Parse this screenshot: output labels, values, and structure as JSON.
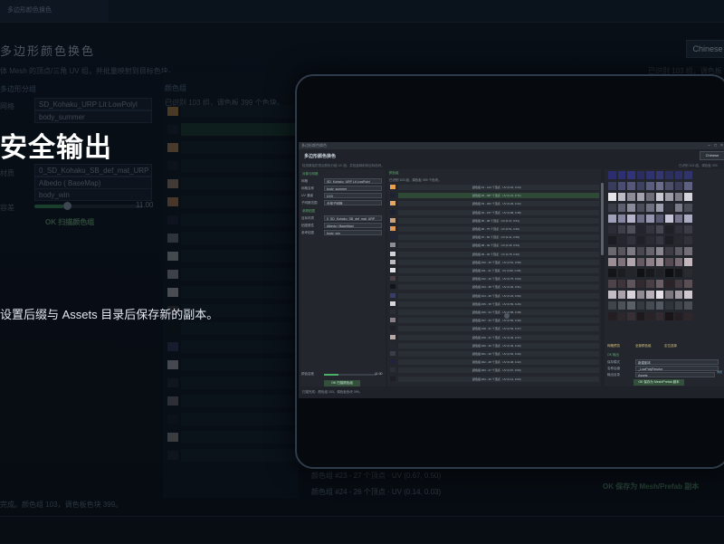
{
  "background": {
    "tab_title": "多边形颜色换色",
    "title": "多边形颜色换色",
    "language": "Chinese",
    "hint": "体 Mesh 的顶点/三角 UV 组，并批量映射到目标色块。",
    "stats": "已识别 103 组，调色板 399 个",
    "left_section": "多边形分组",
    "field_rows": [
      {
        "label": "网格",
        "value": "SD_Kohaku_URP Lit LowPolyl"
      },
      {
        "label": "",
        "value": "body_summer"
      },
      {
        "label": "材质",
        "value": "0_SD_Kohaku_SB_def_mat_URP"
      },
      {
        "label": "",
        "value": "Albedo ( BaseMap)"
      },
      {
        "label": "",
        "value": "body_win"
      }
    ],
    "slider_label": "容差",
    "slider_value": "11.00",
    "slider_fraction": 0.27,
    "scan_button": "OK 扫描颜色组",
    "list_header": "颜色组",
    "list_info": "已识别 103 组，调色板 399 个色块。",
    "bottom_rows": [
      "颜色组 #23 - 27 个顶点 · UV (0.67, 0.50)",
      "颜色组 #24 - 26 个顶点 · UV (0.14, 0.03)"
    ],
    "save_button": "OK 保存为 Mesh/Prefab 副本",
    "status": "完成。颜色组 103，调色板色块 399。"
  },
  "overlay": {
    "headline": "安全输出",
    "subtext": "设置后缀与 Assets 目录后保存新的副本。"
  },
  "screen": {
    "window_title": "多边形颜色换色",
    "title": "多边形颜色换色",
    "language": "Chinese",
    "hint": "检测原始的顶点颜色分组 UV 组，并批量映射到目标色块。",
    "stats": "已识别 103 组，调色板 399",
    "section1": "对象与网格",
    "mesh_label": "网格",
    "mesh_value": "SD_Kohaku_URP Lit LowPolyl",
    "uv_label": "网格名称",
    "uv_value": "body_summer",
    "uvch_label": "UV 通道",
    "uvch_value": "UV0",
    "mode_label": "子网格范围",
    "mode_value": "全部子网格",
    "section2": "参照贴图",
    "mat_label": "目标材质",
    "mat_value": "0_SD_Kohaku_SB_def_mat_URP",
    "tex_label": "贴图属性",
    "tex_value": "Albedo ( BaseMap)",
    "ref_label": "参考贴图",
    "ref_value": "body_win",
    "tol_label": "颜色容差",
    "tol_value": "11.00",
    "tol_fraction": 0.27,
    "scan_button": "OK 扫描颜色组",
    "mid_header": "颜色组",
    "mid_info": "已识别 103 组，调色板 399 个色块。",
    "rows": [
      {
        "text": "颜色组 #1 - 144 个顶点 · UV (0.18, 0.44)",
        "color": "#e8a04c"
      },
      {
        "text": "颜色组 #2 - 387 个顶点 · UV (0.21, 0.71)",
        "color": "#1d2330",
        "selected": true
      },
      {
        "text": "颜色组 #3 - 262 个顶点 · UV (0.29, 0.42)",
        "color": "#e3a664"
      },
      {
        "text": "颜色组 #4 - 157 个顶点 · UV (0.68, 0.38)",
        "color": "#1b2033"
      },
      {
        "text": "颜色组 #5 - 98 个顶点 · UV (0.47, 0.51)",
        "color": "#c9a27e"
      },
      {
        "text": "颜色组 #6 - 75 个顶点 · UV (0.51, 0.66)",
        "color": "#e09a58"
      },
      {
        "text": "颜色组 #7 - 60 个顶点 · UV (0.41, 0.55)",
        "color": "#20253a"
      },
      {
        "text": "颜色组 #8 - 49 个顶点 · UV (0.36, 0.53)",
        "color": "#8e8f95"
      },
      {
        "text": "颜色组 #9 - 46 个顶点 · UV (0.78, 0.30)",
        "color": "#d4d3d8"
      },
      {
        "text": "颜色组 #10 - 45 个顶点 · UV (0.51, 0.58)",
        "color": "#bfbcc1"
      },
      {
        "text": "颜色组 #11 - 41 个顶点 · UV (0.82, 0.68)",
        "color": "#e2e1e6"
      },
      {
        "text": "颜色组 #12 - 40 个顶点 · UV (0.75, 0.60)",
        "color": "#4b3f46"
      },
      {
        "text": "颜色组 #13 - 38 个顶点 · UV (0.40, 0.51)",
        "color": "#121519"
      },
      {
        "text": "颜色组 #14 - 36 个顶点 · UV (0.23, 0.59)",
        "color": "#3a3d6a"
      },
      {
        "text": "颜色组 #15 - 35 个顶点 · UV (0.59, 0.26)",
        "color": "#d7d6db"
      },
      {
        "text": "颜色组 #16 - 34 个顶点 · UV (0.58, 0.48)",
        "color": "#2a2d33"
      },
      {
        "text": "颜色组 #17 - 33 个顶点 · UV (0.50, 0.49)",
        "color": "#8a7f86"
      },
      {
        "text": "颜色组 #18 - 31 个顶点 · UV (0.54, 0.47)",
        "color": "#1e2026"
      },
      {
        "text": "颜色组 #19 - 31 个顶点 · UV (0.49, 0.37)",
        "color": "#b7a9a5"
      },
      {
        "text": "颜色组 #20 - 30 个顶点 · UV (0.46, 0.43)",
        "color": "#26282f"
      },
      {
        "text": "颜色组 #21 - 30 个顶点 · UV (0.52, 0.49)",
        "color": "#3a3d48"
      },
      {
        "text": "颜色组 #22 - 28 个顶点 · UV (0.48, 0.42)",
        "color": "#20233b"
      },
      {
        "text": "颜色组 #23 - 27 个顶点 · UV (0.67, 0.50)",
        "color": "#2c2f35"
      },
      {
        "text": "颜色组 #24 - 26 个顶点 · UV (0.14, 0.03)",
        "color": "#1d1f24"
      }
    ],
    "palette_colors": [
      "#2b2d6e",
      "#2c2f72",
      "#30337a",
      "#2a2c62",
      "#2f3270",
      "#33366f",
      "#2c2e5e",
      "#2d3066",
      "#31346a",
      "#3a3c5c",
      "#4a4c73",
      "#55577a",
      "#3f4160",
      "#5a5c7c",
      "#6a6c8a",
      "#4c4e6a",
      "#3d3f5a",
      "#5f6180",
      "#e6e5ea",
      "#bdbcc4",
      "#8d8c96",
      "#a3a2ad",
      "#6f6e78",
      "#c9c8d0",
      "#9e9da7",
      "#7e7d88",
      "#d5d4db",
      "#3a3c48",
      "#5e6070",
      "#8a8c9c",
      "#4c4e5c",
      "#6e7080",
      "#9a9cac",
      "#2c2e38",
      "#7a7c8c",
      "#4a4c58",
      "#a09fb8",
      "#8786a0",
      "#b5b4cc",
      "#6f6e88",
      "#9796b0",
      "#5a5974",
      "#c4c3d8",
      "#77768e",
      "#ababc2",
      "#2c2d36",
      "#3d3e48",
      "#4e4f5a",
      "#24252c",
      "#33343d",
      "#45464f",
      "#1f2026",
      "#2e2f37",
      "#3b3c45",
      "#1b1c22",
      "#26272e",
      "#30313a",
      "#202127",
      "#2b2c33",
      "#35363f",
      "#1d1e24",
      "#28292f",
      "#313239",
      "#6b6870",
      "#58555d",
      "#7d7a83",
      "#4a4750",
      "#66636b",
      "#8a8790",
      "#3f3c45",
      "#5d5a62",
      "#736f78",
      "#9c8e95",
      "#7f727a",
      "#b2a5ac",
      "#665a62",
      "#8b7e86",
      "#a6989f",
      "#574b53",
      "#786b73",
      "#c4b7be",
      "#141518",
      "#1c1d21",
      "#242529",
      "#101114",
      "#18191d",
      "#202125",
      "#0e0f12",
      "#16171b",
      "#2a2b2f",
      "#4e4349",
      "#3e3439",
      "#5f5459",
      "#332a2f",
      "#483e43",
      "#6a5e64",
      "#2a2226",
      "#443a3f",
      "#5a4f55",
      "#c2bcc4",
      "#a9a2ab",
      "#d8d2da",
      "#918a93",
      "#b7b0b9",
      "#e6e0e8",
      "#7d767f",
      "#a49da6",
      "#cfc8d1",
      "#3f444a",
      "#4c5157",
      "#596066",
      "#353a40",
      "#454a50",
      "#525860",
      "#2f343a",
      "#3e4349",
      "#4a4f55",
      "#241e22",
      "#2e272b",
      "#382f34",
      "#1f191d",
      "#292226",
      "#332b30",
      "#1a1519",
      "#241d21",
      "#2e262b"
    ],
    "right_tabs": [
      "网格预览",
      "全部颜色组",
      "定位选择"
    ],
    "target_section": "OK 输出",
    "out_mode_label": "保存模式",
    "out_mode_value": "新建副本",
    "suffix_label": "名称后缀",
    "suffix_value": "_LowPolyRecolor",
    "dir_label": "输出目录",
    "dir_value": "Assets",
    "browse_label": "浏览",
    "save_button": "OK 保存为 Mesh/Prefab 副本",
    "status": "扫描完成：颜色组 103，调色板色块 399。"
  }
}
